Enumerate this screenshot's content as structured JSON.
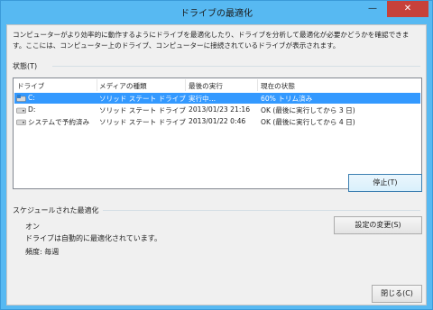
{
  "window": {
    "title": "ドライブの最適化",
    "minimize_glyph": "—",
    "close_glyph": "✕"
  },
  "description": "コンピューターがより効率的に動作するようにドライブを最適化したり、ドライブを分析して最適化が必要かどうかを確認できます。ここには、コンピューター上のドライブ、コンピューターに接続されているドライブが表示されます。",
  "status": {
    "group_label": "状態(T)"
  },
  "table": {
    "headers": [
      "ドライブ",
      "メディアの種類",
      "最後の実行",
      "現在の状態"
    ],
    "rows": [
      {
        "drive": "C:",
        "media": "ソリッド ステート ドライブ",
        "last_run": "実行中...",
        "status": "60% トリム済み",
        "icon": "drive-c-icon"
      },
      {
        "drive": "D:",
        "media": "ソリッド ステート ドライブ",
        "last_run": "2013/01/23 21:16",
        "status": "OK (最後に実行してから 3 日)",
        "icon": "drive-icon"
      },
      {
        "drive": "システムで予約済み",
        "media": "ソリッド ステート ドライブ",
        "last_run": "2013/01/22 0:46",
        "status": "OK (最後に実行してから 4 日)",
        "icon": "drive-icon"
      }
    ]
  },
  "buttons": {
    "stop": "停止(T)",
    "change_settings": "設定の変更(S)",
    "close": "閉じる(C)"
  },
  "schedule": {
    "group_label": "スケジュールされた最適化",
    "state": "オン",
    "description": "ドライブは自動的に最適化されています。",
    "frequency": "頻度: 毎週"
  },
  "colors": {
    "accent": "#57b9f2",
    "selection": "#3399ff",
    "close_button": "#c7413a"
  }
}
